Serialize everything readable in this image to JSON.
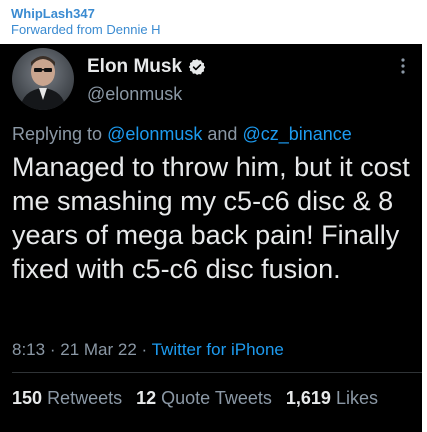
{
  "forward": {
    "sender": "WhipLash347",
    "from_label": "Forwarded from Dennie H"
  },
  "tweet": {
    "name": "Elon Musk",
    "handle": "@elonmusk",
    "reply_prefix": "Replying to",
    "mention_1": "@elonmusk",
    "reply_and": "and",
    "mention_2": "@cz_binance",
    "body": "Managed to throw him, but it cost me smashing my c5-c6 disc & 8 years of mega back pain! Finally fixed with c5-c6 disc fusion.",
    "time": "8:13",
    "sep1": "·",
    "date": "21 Mar 22",
    "sep2": "·",
    "source": "Twitter for iPhone",
    "retweets_count": "150",
    "retweets_label": "Retweets",
    "quotes_count": "12",
    "quotes_label": "Quote Tweets",
    "likes_count": "1,619",
    "likes_label": "Likes"
  },
  "icons": {
    "verified": "verified-badge-icon",
    "more": "more-vertical-icon"
  },
  "colors": {
    "forward_text": "#3a8bd1",
    "tweet_bg": "#000000",
    "primary_text": "#e7e9ea",
    "secondary_text": "#8b98a5",
    "link": "#1d9bf0"
  }
}
